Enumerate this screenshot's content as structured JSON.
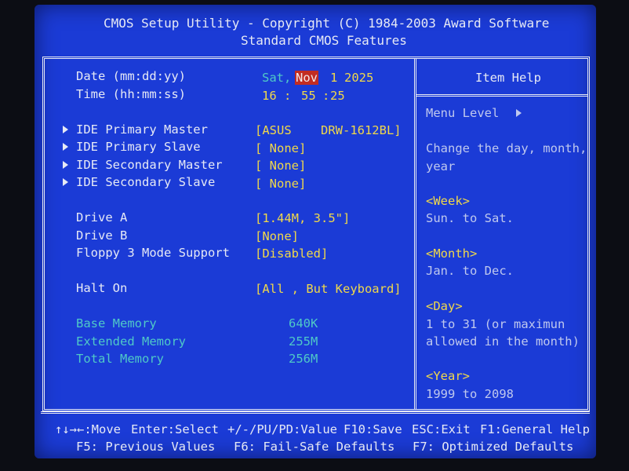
{
  "header": {
    "line1": "CMOS Setup Utility - Copyright (C) 1984-2003 Award Software",
    "line2": "Standard CMOS Features"
  },
  "datetime": {
    "date_label": "Date (mm:dd:yy)",
    "time_label": "Time (hh:mm:ss)",
    "weekday": "Sat,",
    "month": "Nov",
    "day": "1",
    "year": "2025",
    "hour": "16",
    "minute": "55",
    "second": "25",
    "sep": ":"
  },
  "ide": [
    {
      "label": "IDE Primary Master",
      "value": "[ASUS    DRW-1612BL]"
    },
    {
      "label": "IDE Primary Slave",
      "value": "[ None]"
    },
    {
      "label": "IDE Secondary Master",
      "value": "[ None]"
    },
    {
      "label": "IDE Secondary Slave",
      "value": "[ None]"
    }
  ],
  "drives": [
    {
      "label": "Drive A",
      "value": "[1.44M, 3.5\"]"
    },
    {
      "label": "Drive B",
      "value": "[None]"
    },
    {
      "label": "Floppy 3 Mode Support",
      "value": "[Disabled]"
    }
  ],
  "halt": {
    "label": "Halt On",
    "value": "[All , But Keyboard]"
  },
  "memory": [
    {
      "label": "Base Memory",
      "value": "640K"
    },
    {
      "label": "Extended Memory",
      "value": "255M"
    },
    {
      "label": "Total Memory",
      "value": "256M"
    }
  ],
  "help": {
    "title": "Item Help",
    "menu_level": "Menu Level",
    "desc1": "Change the day, month,",
    "desc2": "year",
    "week_head": "<Week>",
    "week_body": "Sun. to Sat.",
    "month_head": "<Month>",
    "month_body": "Jan. to Dec.",
    "day_head": "<Day>",
    "day_body1": "1 to 31 (or maximun",
    "day_body2": "allowed in the month)",
    "year_head": "<Year>",
    "year_body": "1999 to 2098"
  },
  "footer": {
    "row1": [
      "↑↓→←:Move",
      "Enter:Select",
      "+/-/PU/PD:Value",
      "F10:Save",
      "ESC:Exit",
      "F1:General Help"
    ],
    "row2": [
      "F5: Previous Values",
      "F6: Fail-Safe Defaults",
      "F7: Optimized Defaults"
    ]
  },
  "colors": {
    "background": "#1b3bd6",
    "value_yellow": "#f0d84a",
    "memory_cyan": "#4fc9c7",
    "highlight_red": "#c22c22"
  }
}
